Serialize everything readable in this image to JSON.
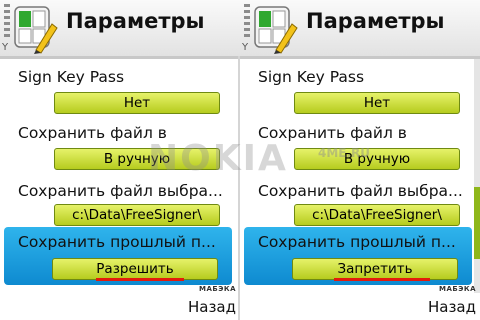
{
  "screens": [
    {
      "title": "Параметры",
      "items": [
        {
          "label": "Sign Key Pass",
          "value": "Нет"
        },
        {
          "label": "Сохранить файл в",
          "value": "В ручную"
        },
        {
          "label": "Сохранить файл выбра...",
          "value": "c:\\Data\\FreeSigner\\"
        },
        {
          "label": "Сохранить прошлый п...",
          "value": "Разрешить"
        }
      ],
      "brand": "МАБЭКА",
      "softkey_right": "Назад"
    },
    {
      "title": "Параметры",
      "items": [
        {
          "label": "Sign Key Pass",
          "value": "Нет"
        },
        {
          "label": "Сохранить файл в",
          "value": "В ручную"
        },
        {
          "label": "Сохранить файл выбра...",
          "value": "c:\\Data\\FreeSigner\\"
        },
        {
          "label": "Сохранить прошлый п...",
          "value": "Запретить"
        }
      ],
      "brand": "МАБЭКА",
      "softkey_right": "Назад"
    }
  ],
  "watermark": {
    "text": "NOKIA",
    "sub": "4ME.RU"
  },
  "colors": {
    "selection": "#1ea3e2",
    "value_bg": "#cfe03a",
    "underline": "#e31b0c"
  }
}
